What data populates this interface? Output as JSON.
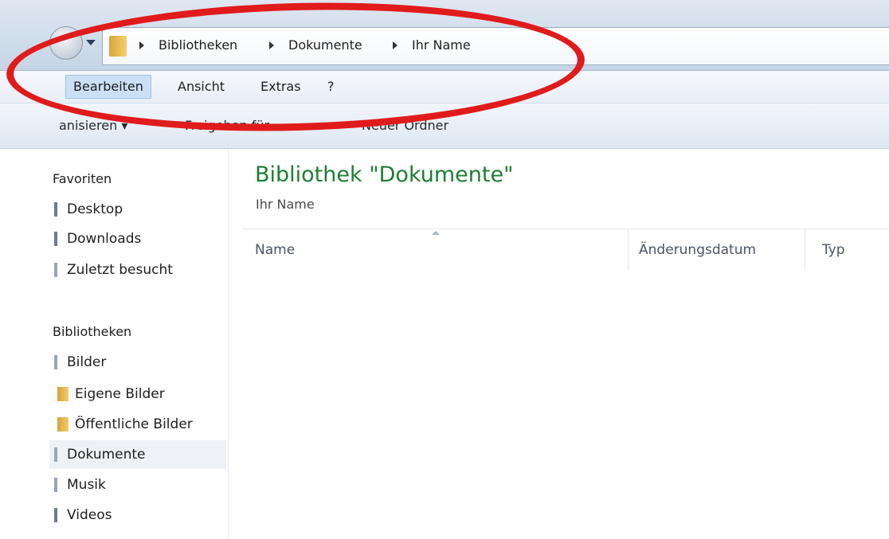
{
  "address_bar": {
    "breadcrumbs": [
      "Bibliotheken",
      "Dokumente",
      "Ihr Name"
    ]
  },
  "menu": {
    "items": [
      "Bearbeiten",
      "Ansicht",
      "Extras",
      "?"
    ]
  },
  "toolbar": {
    "organize": "anisieren ▾",
    "share": "Freigeben für",
    "new_folder": "Neuer Ordner"
  },
  "navigation": {
    "favorites_heading": "Favoriten",
    "favorites": [
      "Desktop",
      "Downloads",
      "Zuletzt besucht"
    ],
    "libraries_heading": "Bibliotheken",
    "libraries": [
      "Bilder",
      "Eigene Bilder",
      "Öffentliche Bilder",
      "Dokumente",
      "Musik",
      "Videos"
    ]
  },
  "content": {
    "title": "Bibliothek \"Dokumente\"",
    "subtitle": "Ihr Name",
    "columns": [
      "Name",
      "Änderungsdatum",
      "Typ"
    ]
  },
  "colors": {
    "title_green": "#1e7e34",
    "annotation_red": "#e01b1b",
    "menu_highlight": "#cbe0f7"
  }
}
